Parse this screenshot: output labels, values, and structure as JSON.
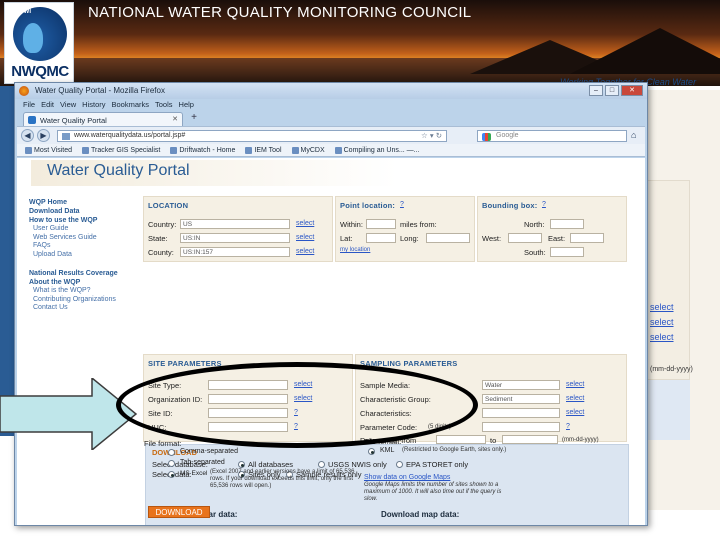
{
  "banner": {
    "title": "NATIONAL WATER QUALITY MONITORING COUNCIL",
    "logo_text": "NWQMC",
    "logo_small": "ACWI",
    "tagline": "Working Together for Clean Water"
  },
  "browser": {
    "window_title": "Water Quality Portal - Mozilla Firefox",
    "menu": [
      "File",
      "Edit",
      "View",
      "History",
      "Bookmarks",
      "Tools",
      "Help"
    ],
    "tab_label": "Water Quality Portal",
    "url": "www.waterqualitydata.us/portal.jsp#",
    "search_placeholder": "Google",
    "bookmarks": [
      "Most Visited",
      "Tracker GIS Specialist",
      "Driftwatch - Home",
      "IEM Tool",
      "MyCDX",
      "Compiling an Uns... —..."
    ]
  },
  "page": {
    "title": "Water Quality Portal",
    "nav": {
      "top": [
        "WQP Home",
        "Download Data",
        "How to use the WQP"
      ],
      "sub1": [
        "User Guide",
        "Web Services Guide",
        "FAQs",
        "Upload Data"
      ],
      "mid": [
        "National Results Coverage",
        "About the WQP"
      ],
      "sub2": [
        "What is the WQP?",
        "Contributing Organizations",
        "Contact Us"
      ]
    },
    "location": {
      "header": "LOCATION",
      "country_label": "Country:",
      "country_value": "US",
      "state_label": "State:",
      "state_value": "US:IN",
      "county_label": "County:",
      "county_value": "US:IN:157",
      "select": "select"
    },
    "point": {
      "header": "Point location:",
      "help": "?",
      "within_label": "Within:",
      "miles_label": "miles from:",
      "lat_label": "Lat:",
      "long_label": "Long:",
      "my_location": "my location"
    },
    "bbox": {
      "header": "Bounding box:",
      "help": "?",
      "north_label": "North:",
      "west_label": "West:",
      "east_label": "East:",
      "south_label": "South:"
    },
    "site": {
      "header": "SITE PARAMETERS",
      "site_type_label": "Site Type:",
      "org_label": "Organization ID:",
      "site_id_label": "Site ID:",
      "huc_label": "HUC:",
      "select": "select",
      "help": "?"
    },
    "sampling": {
      "header": "SAMPLING PARAMETERS",
      "media_label": "Sample Media:",
      "media_value": "Water",
      "group_label": "Characteristic Group:",
      "group_value": "Sediment",
      "char_label": "Characteristics:",
      "param_label": "Parameter Code:",
      "param_hint": "(5 digits)",
      "date_label": "Date range: from",
      "date_to": "to",
      "date_hint": "(mm-dd-yyyy)",
      "select": "select",
      "help": "?"
    },
    "download": {
      "header": "DOWNLOAD",
      "db_label": "Select database:",
      "db_options": [
        "All databases",
        "USGS NWIS only",
        "EPA STORET only"
      ],
      "data_label": "Select data:",
      "data_options": [
        "Sites only",
        "Sample results only"
      ],
      "tabular_title": "Download tabular data:",
      "file_format": "File format:",
      "formats": [
        "Comma-separated",
        "Tab-separated",
        "MS Excel"
      ],
      "excel_note": "(Excel 2007 and earlier versions have a limit of 65,536 rows. If your download exceeds this limit, only the first 65,536 rows will open.)",
      "map_title": "Download map data:",
      "map_file": "File format:",
      "kml": "KML",
      "kml_note": "(Restricted to Google Earth, sites only.)",
      "google_link": "Show data on Google Maps",
      "google_note": "Google Maps limits the number of sites shown to a maximum of 1000. It will also time out if the query is slow.",
      "button": "DOWNLOAD"
    }
  },
  "background": {
    "select_labels": [
      "select",
      "select",
      "select"
    ],
    "date_hint": "(mm-dd-yyyy)"
  }
}
